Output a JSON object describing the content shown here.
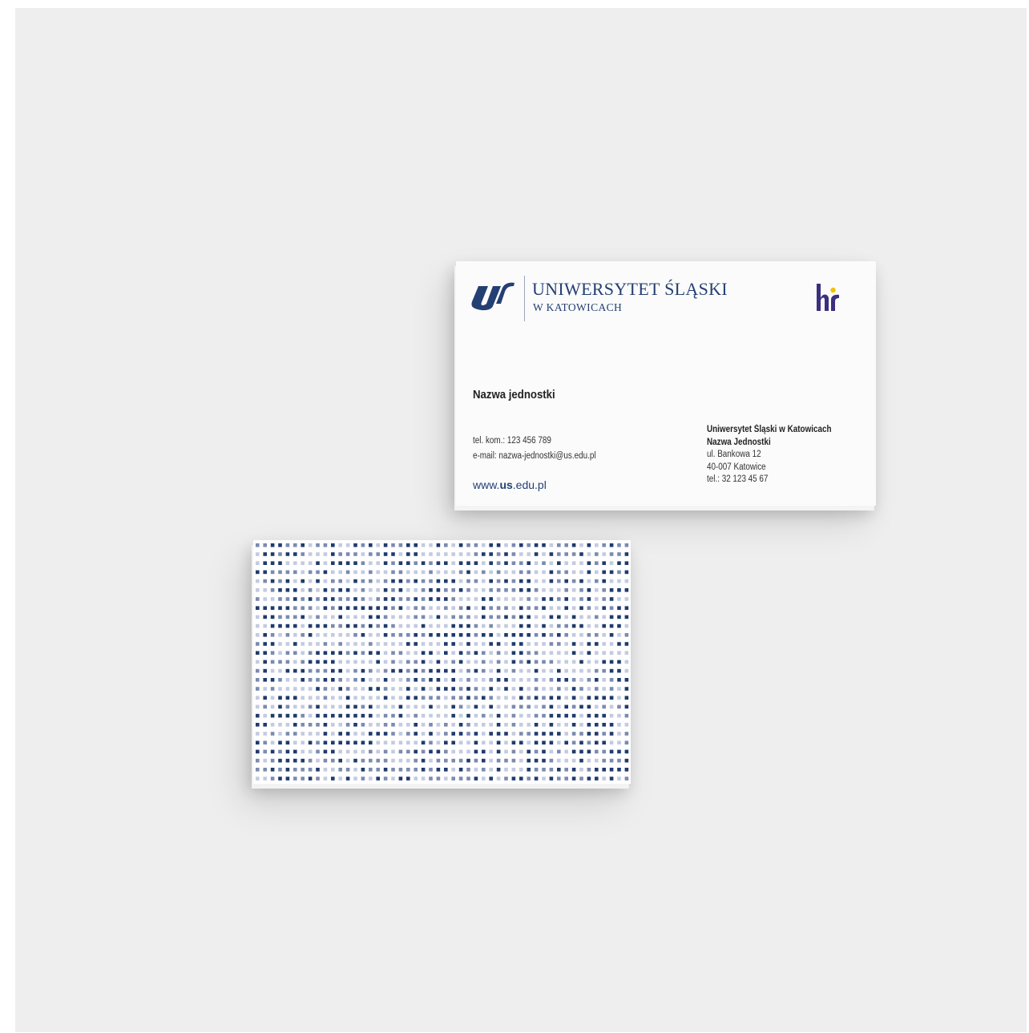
{
  "front": {
    "university": {
      "name": "UNIWERSYTET ŚLĄSKI",
      "location": "W KATOWICACH"
    },
    "unit_name": "Nazwa jednostki",
    "contact": {
      "phone": "tel. kom.: 123 456 789",
      "email": "e-mail: nazwa-jednostki@us.edu.pl"
    },
    "website": {
      "prefix": "www.",
      "bold": "us",
      "suffix": ".edu.pl"
    },
    "address": {
      "org": "Uniwersytet Śląski w Katowicach",
      "unit": "Nazwa Jednostki",
      "street": "ul. Bankowa 12",
      "city": "40-007 Katowice",
      "phone": "tel.: 32 123 45 67"
    }
  },
  "colors": {
    "brand_navy": "#233f73",
    "pattern_dark": "#1f3b6e",
    "pattern_mid": "#7b8bb0",
    "pattern_light": "#c4cbe0",
    "hr_purple": "#3b2f7f",
    "hr_yellow": "#f2c100"
  }
}
